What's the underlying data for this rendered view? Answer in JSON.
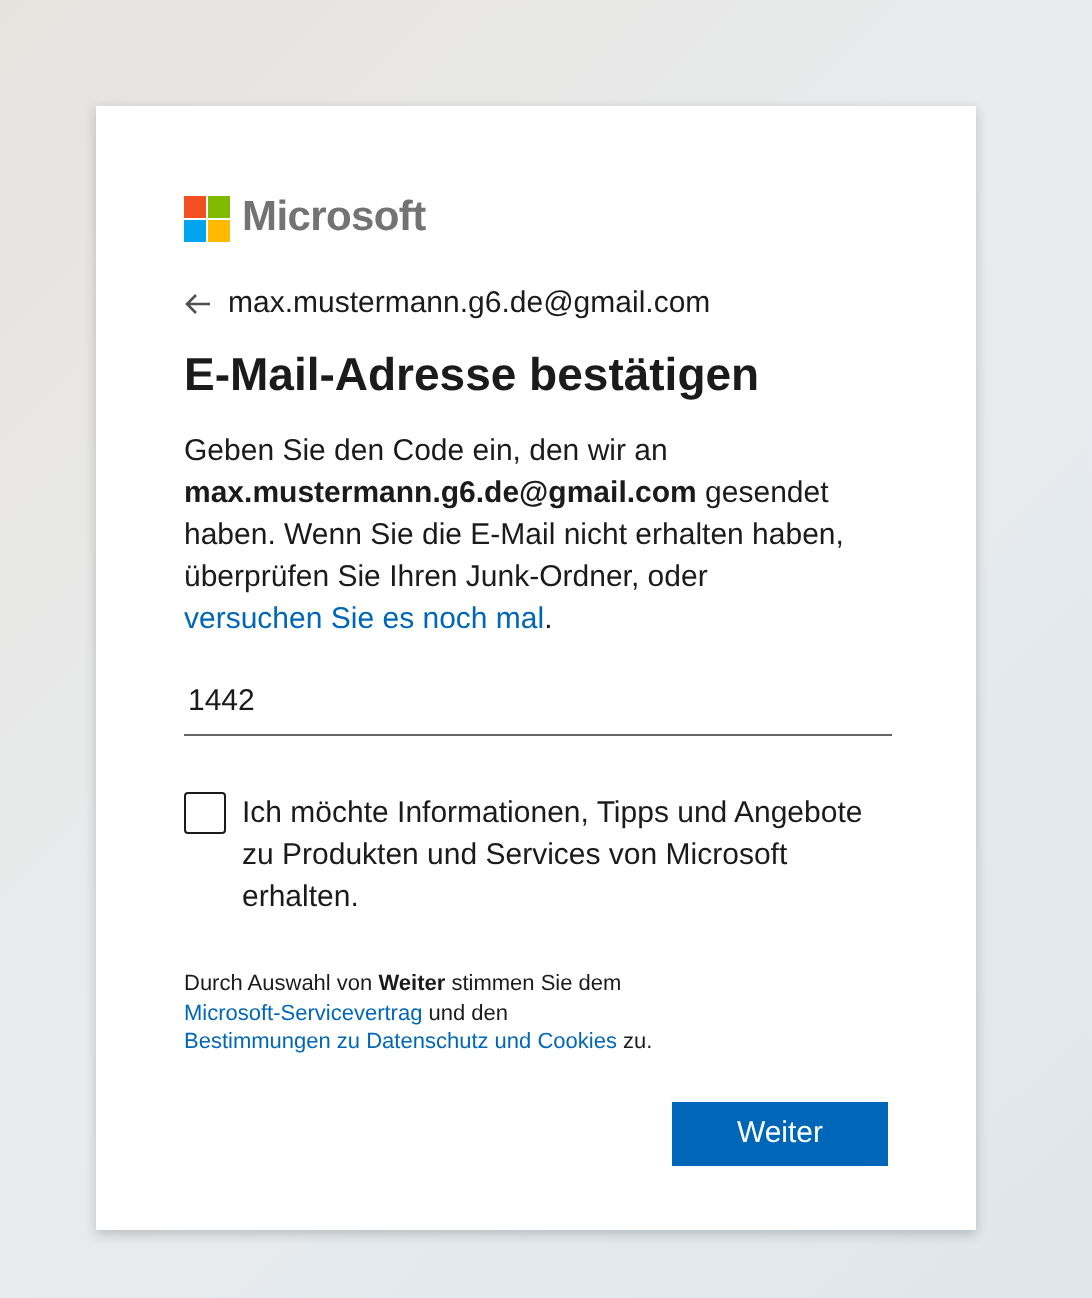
{
  "logo": {
    "text": "Microsoft"
  },
  "back": {
    "email": "max.mustermann.g6.de@gmail.com"
  },
  "title": "E-Mail-Adresse bestätigen",
  "description": [
    {
      "kind": "text",
      "text": "Geben Sie den Code ein, den wir an **max.mustermann.g6.de@gmail.com** gesendet haben. Wenn Sie die E-Mail nicht erhalten haben, überprüfen Sie Ihren Junk-Ordner, oder "
    },
    {
      "kind": "link",
      "text": "versuchen Sie es noch mal"
    },
    {
      "kind": "text",
      "text": "."
    }
  ],
  "code_field": {
    "value": "1442"
  },
  "consent": {
    "checked": false,
    "label": "Ich möchte Informationen, Tipps und Angebote zu Produkten und Services von Microsoft erhalten."
  },
  "terms": [
    {
      "kind": "text",
      "text": "Durch Auswahl von **Weiter** stimmen Sie dem "
    },
    {
      "kind": "link",
      "text": "Microsoft-Servicevertrag"
    },
    {
      "kind": "text",
      "text": " und den "
    },
    {
      "kind": "link",
      "text": "Bestimmungen zu Datenschutz und Cookies"
    },
    {
      "kind": "text",
      "text": " zu."
    }
  ],
  "button": "Weiter"
}
